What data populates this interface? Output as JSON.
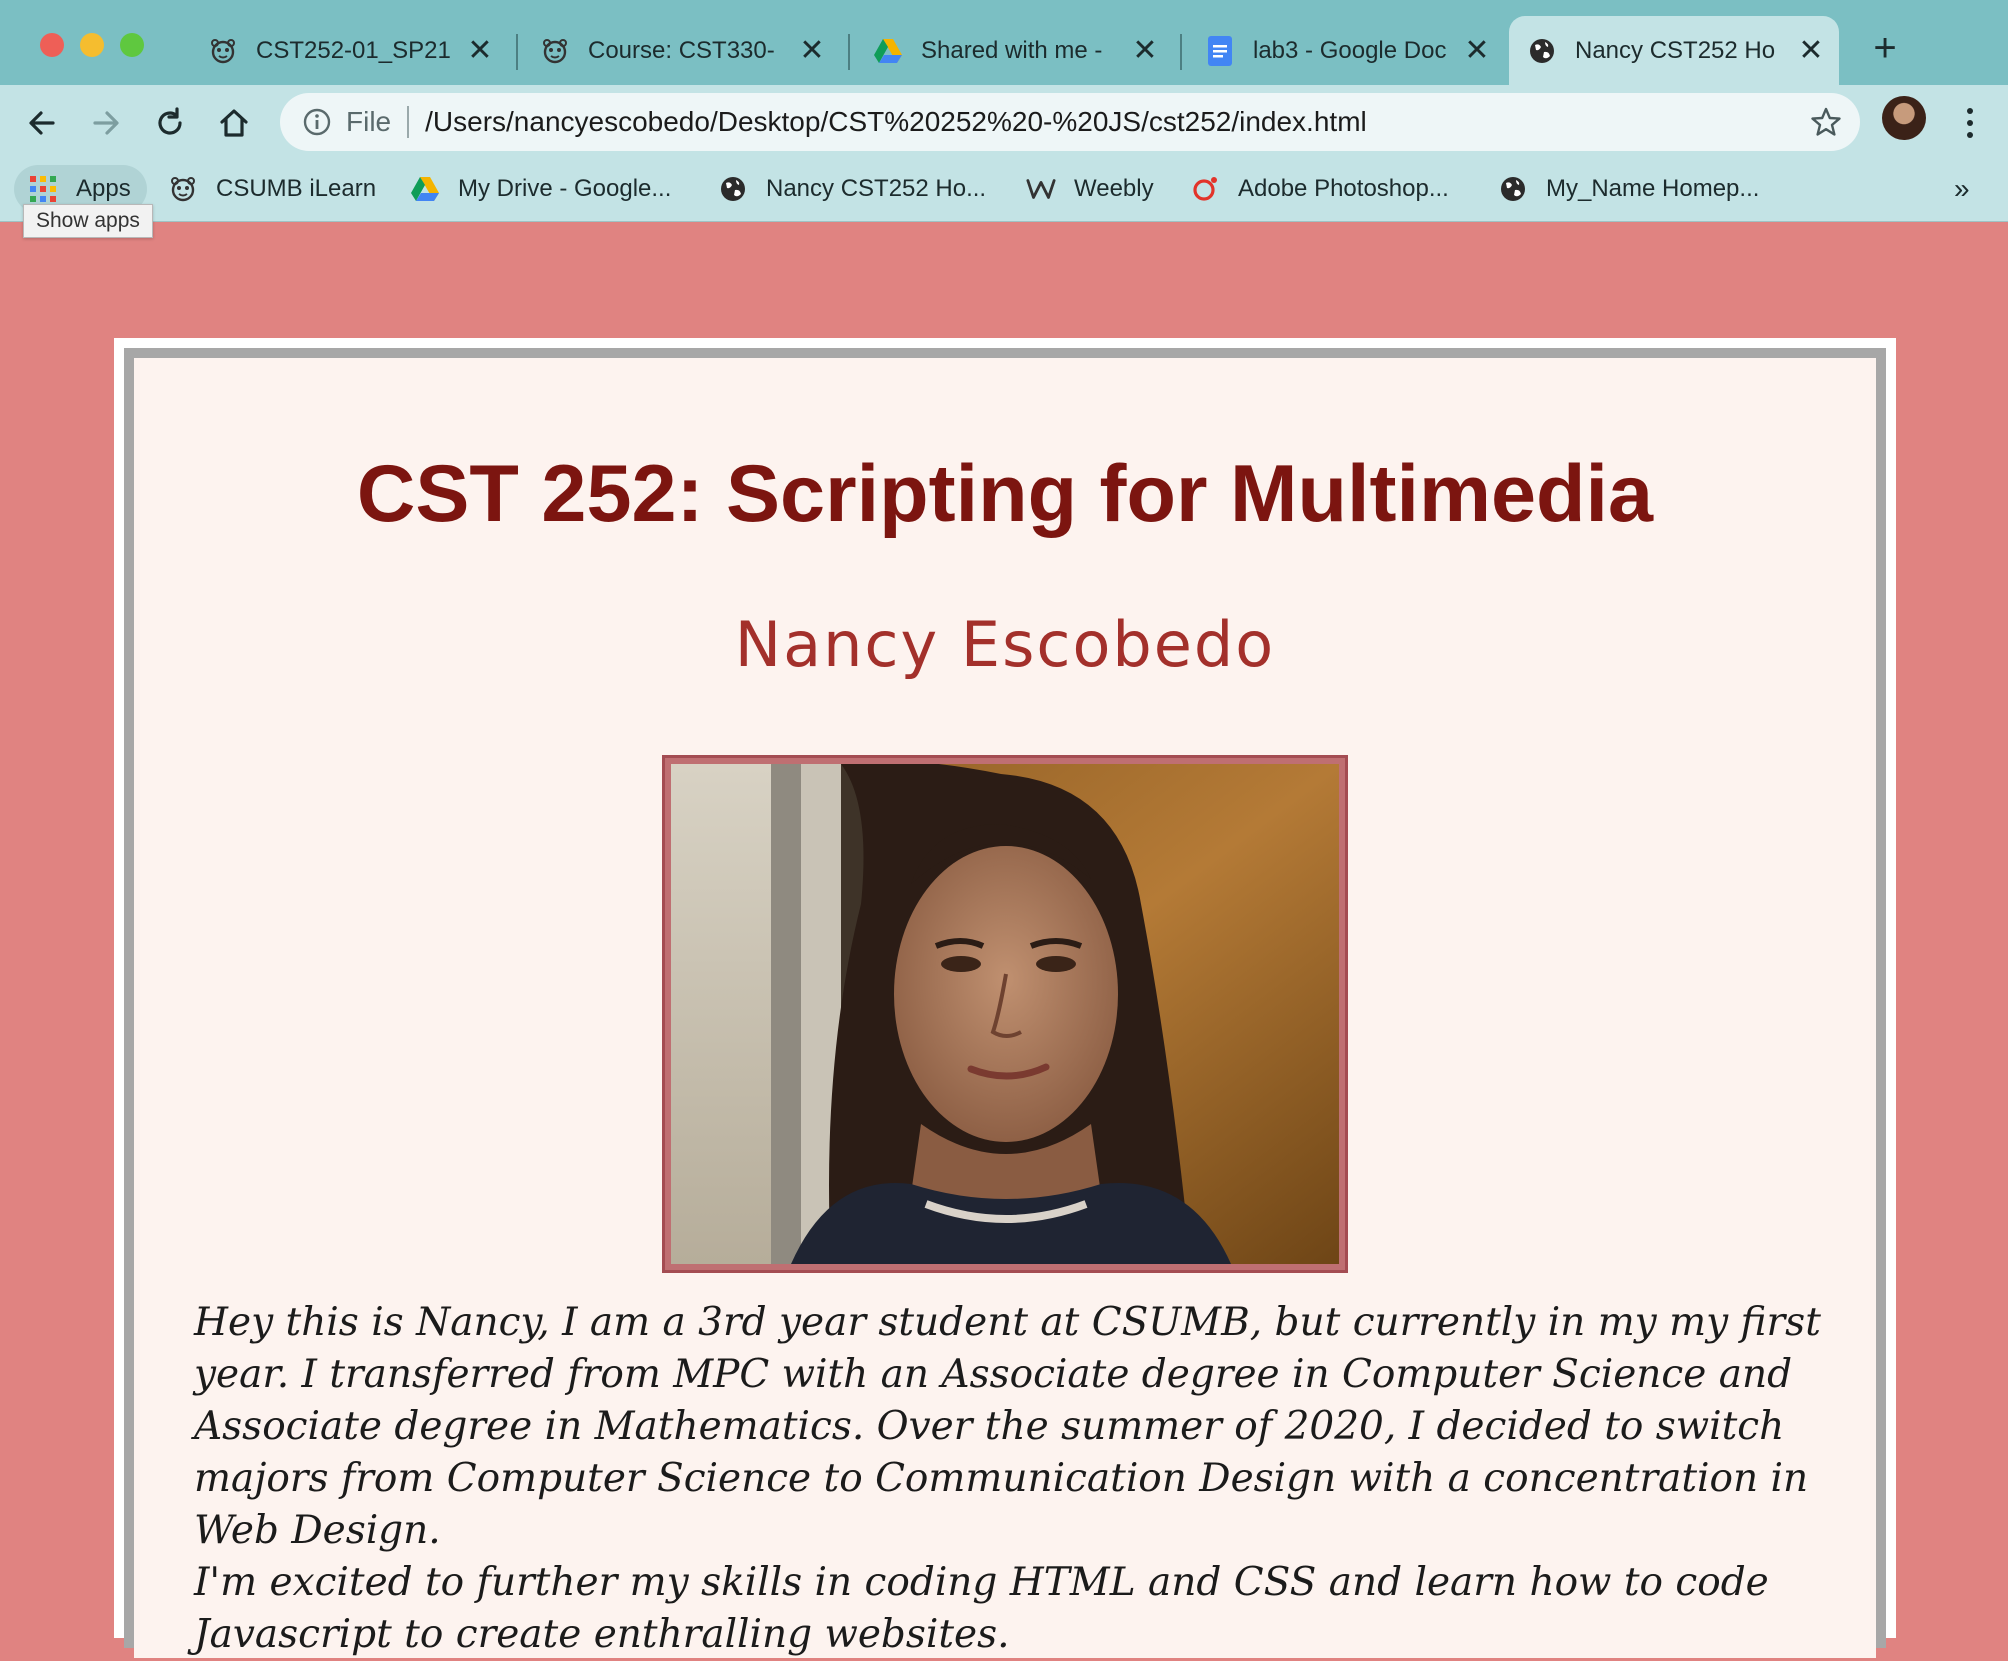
{
  "browser": {
    "tabs": [
      {
        "title": "CST252-01_SP21",
        "icon": "csumb-otter-icon",
        "active": false
      },
      {
        "title": "Course: CST330-",
        "icon": "csumb-otter-icon",
        "active": false
      },
      {
        "title": "Shared with me -",
        "icon": "google-drive-icon",
        "active": false
      },
      {
        "title": "lab3 - Google Doc",
        "icon": "google-docs-icon",
        "active": false
      },
      {
        "title": "Nancy CST252 Ho",
        "icon": "globe-icon",
        "active": true
      }
    ],
    "address": {
      "scheme_label": "File",
      "url": "/Users/nancyescobedo/Desktop/CST%20252%20-%20JS/cst252/index.html"
    },
    "bookmarks": [
      {
        "label": "Apps",
        "icon": "apps-grid-icon"
      },
      {
        "label": "CSUMB iLearn",
        "icon": "csumb-otter-icon"
      },
      {
        "label": "My Drive - Google...",
        "icon": "google-drive-icon"
      },
      {
        "label": "Nancy CST252 Ho...",
        "icon": "globe-icon"
      },
      {
        "label": "Weebly",
        "icon": "weebly-icon"
      },
      {
        "label": "Adobe Photoshop...",
        "icon": "photoshop-icon"
      },
      {
        "label": "My_Name Homep...",
        "icon": "globe-icon"
      }
    ],
    "more_bookmarks": "»",
    "tooltip": "Show apps",
    "colors": {
      "tabstrip": "#7bbfc3",
      "toolbar": "#c3e3e5"
    }
  },
  "page": {
    "title": "CST 252: Scripting for Multimedia",
    "author": "Nancy Escobedo",
    "photo_alt": "Portrait of Nancy Escobedo",
    "bio": [
      "Hey this is Nancy, I am a 3rd year student at CSUMB, but currently in my my first year. I transferred from MPC with an Associate degree in Computer Science and Associate degree in Mathematics. Over the summer of 2020, I decided to switch majors from Computer Science to Communication Design with a concentration in Web Design.",
      "I'm excited to further my skills in coding HTML and CSS and learn how to code Javascript to create enthralling websites."
    ],
    "colors": {
      "background": "#e08381",
      "title": "#7c1510",
      "author": "#a3302b",
      "card": "#fdf3ef"
    }
  }
}
